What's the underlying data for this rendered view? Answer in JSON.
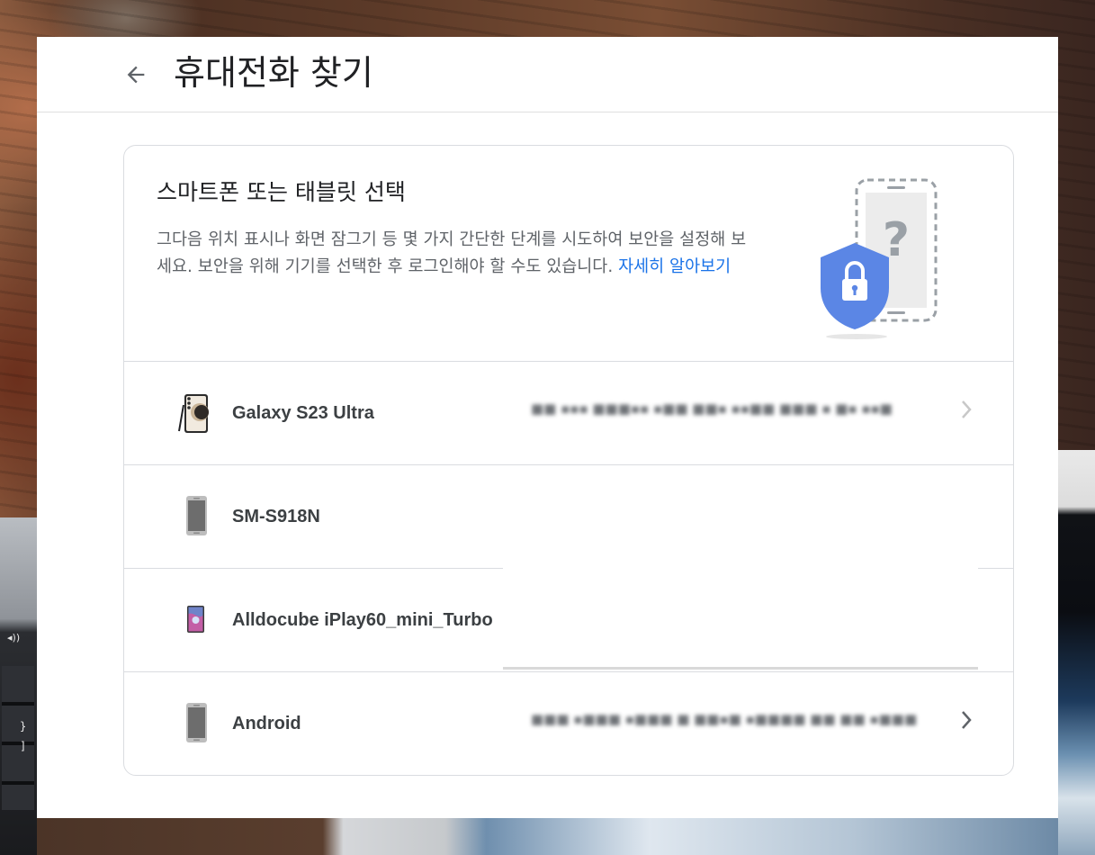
{
  "header": {
    "back_label": "←",
    "title": "휴대전화 찾기"
  },
  "intro": {
    "title": "스마트폰 또는 태블릿 선택",
    "description": "그다음 위치 표시나 화면 잠그기 등 몇 가지 간단한 단계를 시도하여 보안을 설정해 보세요. 보안을 위해 기기를 선택한 후 로그인해야 할 수도 있습니다.",
    "learn_more": "자세히 알아보기",
    "illustration_icon": "phone-lock-question-illustration"
  },
  "devices": [
    {
      "name": "Galaxy S23 Ultra",
      "icon": "galaxy-s23-ultra-icon"
    },
    {
      "name": "SM-S918N",
      "icon": "generic-phone-icon"
    },
    {
      "name": "Alldocube iPlay60_mini_Turbo",
      "icon": "tablet-icon"
    },
    {
      "name": "Android",
      "icon": "generic-phone-icon"
    }
  ],
  "colors": {
    "accent": "#1a73e8",
    "shield": "#5b86e5",
    "title_text": "#202124",
    "body_text": "#5f6368"
  }
}
